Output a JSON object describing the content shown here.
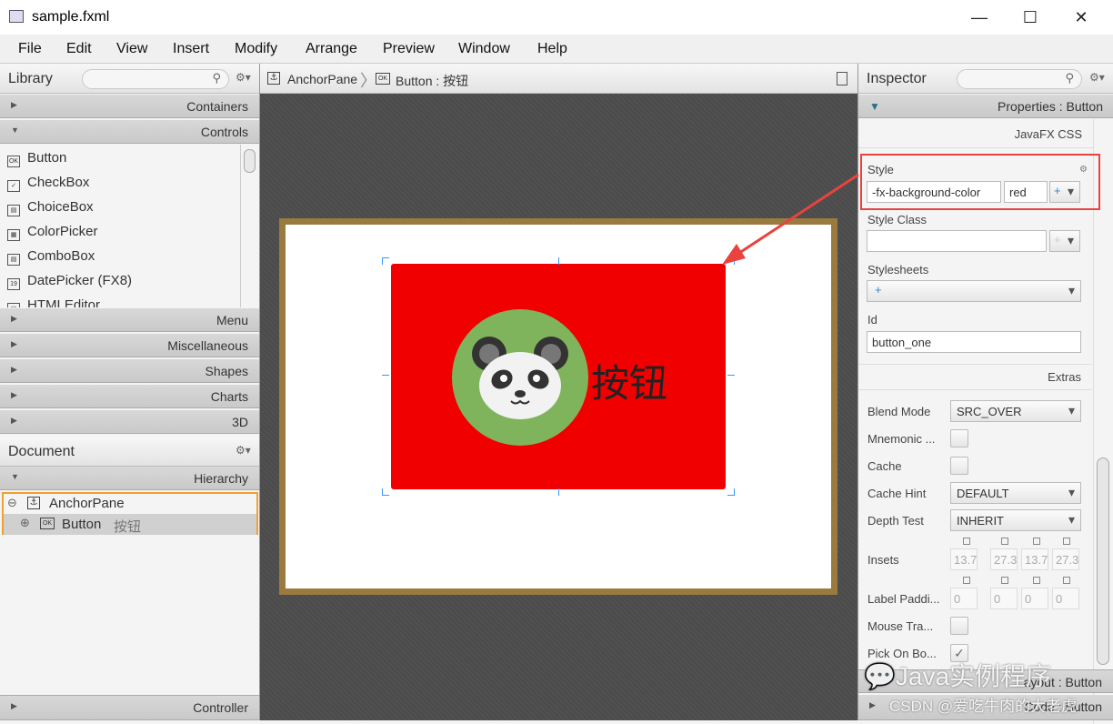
{
  "window": {
    "title": "sample.fxml",
    "min": "—",
    "max": "☐",
    "close": "✕"
  },
  "menu": [
    "File",
    "Edit",
    "View",
    "Insert",
    "Modify",
    "Arrange",
    "Preview",
    "Window",
    "Help"
  ],
  "library": {
    "title": "Library",
    "sections_top": [
      {
        "label": "Containers",
        "expanded": false
      },
      {
        "label": "Controls",
        "expanded": true
      }
    ],
    "controls": [
      {
        "icon": "OK",
        "label": "Button"
      },
      {
        "icon": "✓",
        "label": "CheckBox"
      },
      {
        "icon": "▤",
        "label": "ChoiceBox"
      },
      {
        "icon": "▦",
        "label": "ColorPicker"
      },
      {
        "icon": "▤",
        "label": "ComboBox"
      },
      {
        "icon": "19",
        "label": "DatePicker  (FX8)"
      },
      {
        "icon": "<>",
        "label": "HTMLEditor"
      }
    ],
    "sections_bottom": [
      "Menu",
      "Miscellaneous",
      "Shapes",
      "Charts",
      "3D"
    ]
  },
  "document": {
    "title": "Document",
    "hierarchy": "Hierarchy",
    "tree": [
      {
        "label": "AnchorPane",
        "toggle": "⊖"
      },
      {
        "label": "Button",
        "extra": "按钮",
        "toggle": "⊕"
      }
    ],
    "controller": "Controller"
  },
  "breadcrumb": [
    "AnchorPane",
    "Button : 按钮"
  ],
  "canvas": {
    "button_text": "按钮",
    "button_color": "#f00000",
    "frame_color": "#9b7a3f"
  },
  "inspector": {
    "title": "Inspector",
    "properties": "Properties : Button",
    "javafx_css": "JavaFX CSS",
    "style_label": "Style",
    "style_property": "-fx-background-color",
    "style_value": "red",
    "style_class_label": "Style Class",
    "stylesheets_label": "Stylesheets",
    "stylesheets_add": "+",
    "id_label": "Id",
    "id_value": "button_one",
    "extras": "Extras",
    "blend_mode_label": "Blend Mode",
    "blend_mode": "SRC_OVER",
    "mnemonic_label": "Mnemonic ...",
    "cache_label": "Cache",
    "cache_hint_label": "Cache Hint",
    "cache_hint": "DEFAULT",
    "depth_test_label": "Depth Test",
    "depth_test": "INHERIT",
    "insets_label": "Insets",
    "insets": [
      "13.7",
      "27.3",
      "13.7",
      "27.3"
    ],
    "label_padding_label": "Label Paddi...",
    "label_padding": [
      "0",
      "0",
      "0",
      "0"
    ],
    "mouse_label": "Mouse Tra...",
    "pick_label": "Pick On Bo...",
    "pick_checked": true,
    "layout": "Layout : Button",
    "code": "Code : Button"
  },
  "watermark": {
    "line1": "Java实例程序",
    "line2": "CSDN @爱吃牛肉的大老虎"
  },
  "colors": {
    "highlight": "#e8433f"
  }
}
